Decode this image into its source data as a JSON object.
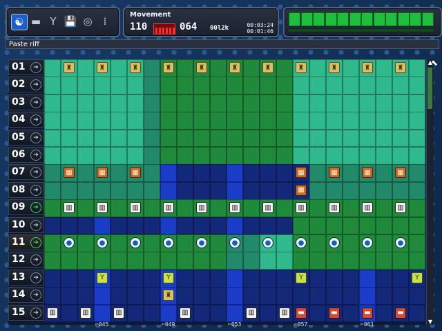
{
  "toolbar": {
    "tools": [
      {
        "name": "song-mode-icon",
        "glyph": "☯",
        "active": true
      },
      {
        "name": "screen-icon",
        "glyph": "▬",
        "active": false
      },
      {
        "name": "tools-icon",
        "glyph": "Y",
        "active": false
      },
      {
        "name": "disk-icon",
        "glyph": "💾",
        "active": false
      },
      {
        "name": "record-icon",
        "glyph": "◎",
        "active": false
      },
      {
        "name": "grid-icon",
        "glyph": "⁞",
        "active": false
      }
    ]
  },
  "song": {
    "title": "Movement",
    "tempo": "110",
    "pattern": "064",
    "size": "00l2k",
    "time_total": "00:03:24",
    "time_elapsed": "00:01:46"
  },
  "vu": {
    "segments": 12,
    "color": "#1fbf3e"
  },
  "status": {
    "text": "Paste riff"
  },
  "rows": [
    "01",
    "02",
    "03",
    "04",
    "05",
    "06",
    "07",
    "08",
    "09",
    "10",
    "11",
    "12",
    "13",
    "14",
    "15"
  ],
  "selected_rows": [
    "09",
    "11"
  ],
  "column_markers": [
    "045",
    "049",
    "053",
    "057",
    "061"
  ],
  "colors": {
    "teal": "#2fb98d",
    "green": "#1f8a3c",
    "dark_blue": "#14287a",
    "bright_blue": "#1a3cc8",
    "teal_dark": "#23896b"
  }
}
